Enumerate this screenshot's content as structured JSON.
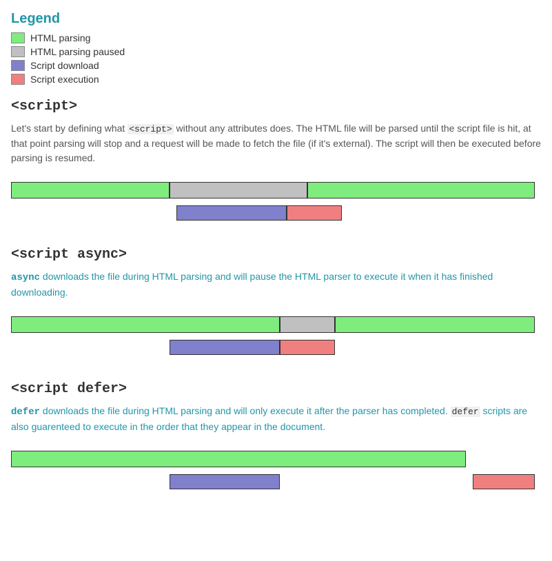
{
  "legend": {
    "title": "Legend",
    "items": [
      {
        "id": "html-parsing",
        "label": "HTML parsing",
        "color": "#7eed7e"
      },
      {
        "id": "html-parsing-paused",
        "label": "HTML parsing paused",
        "color": "#c0c0c0"
      },
      {
        "id": "script-download",
        "label": "Script download",
        "color": "#8080cc"
      },
      {
        "id": "script-execution",
        "label": "Script execution",
        "color": "#f08080"
      }
    ]
  },
  "sections": [
    {
      "id": "script",
      "heading": "<script>",
      "description_parts": [
        {
          "text": "Let's start by defining what ",
          "type": "normal"
        },
        {
          "text": "<script>",
          "type": "code"
        },
        {
          "text": " without any attributes does. The HTML file will be parsed until the script file is hit, at that point parsing will stop and a request will be made to fetch the file (if it's external). The script will then be executed before parsing is resumed.",
          "type": "normal"
        }
      ]
    },
    {
      "id": "script-async",
      "heading": "<script async>",
      "description_parts": [
        {
          "text": "async",
          "type": "keyword"
        },
        {
          "text": " downloads the file during HTML parsing and will pause the HTML parser to execute it when it has finished downloading.",
          "type": "highlight-blue"
        }
      ]
    },
    {
      "id": "script-defer",
      "heading": "<script defer>",
      "description_parts": [
        {
          "text": "defer",
          "type": "keyword"
        },
        {
          "text": " downloads the file during HTML parsing and will only execute it after the parser has completed. ",
          "type": "highlight-blue"
        },
        {
          "text": "defer",
          "type": "code"
        },
        {
          "text": " scripts are also guarenteed to execute in the order that they appear in the document.",
          "type": "highlight-blue"
        }
      ]
    }
  ],
  "colors": {
    "green": "#7eed7e",
    "gray": "#c0c0c0",
    "blue": "#8080cc",
    "pink": "#f08080",
    "heading": "#333",
    "text_blue": "#2196a8"
  }
}
